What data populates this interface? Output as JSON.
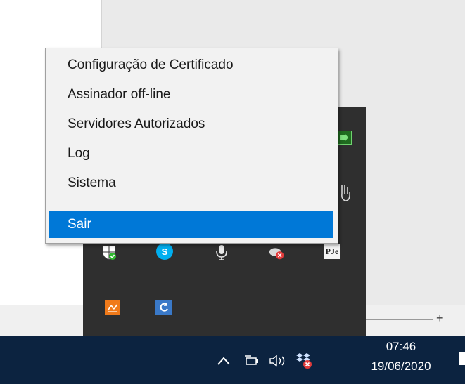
{
  "context_menu": {
    "items": [
      {
        "label": "Configuração de Certificado"
      },
      {
        "label": "Assinador off-line"
      },
      {
        "label": "Servidores Autorizados"
      },
      {
        "label": "Log"
      },
      {
        "label": "Sistema"
      }
    ],
    "exit_label": "Sair",
    "highlight_color": "#0078d7"
  },
  "tray_overflow": {
    "icons": [
      "green-arrow-icon",
      "hand-icon",
      "shield-check-icon",
      "skype-icon",
      "microphone-icon",
      "cloud-error-icon",
      "pjc-icon",
      "signature-app-icon",
      "refresh-app-icon"
    ],
    "pjc_text": "PJe"
  },
  "zoom": {
    "plus_label": "+"
  },
  "taskbar": {
    "icons": [
      "chevron-up-icon",
      "network-icon",
      "volume-icon",
      "dropbox-error-icon"
    ],
    "time": "07:46",
    "date": "19/06/2020",
    "background_color": "#0c2340"
  }
}
